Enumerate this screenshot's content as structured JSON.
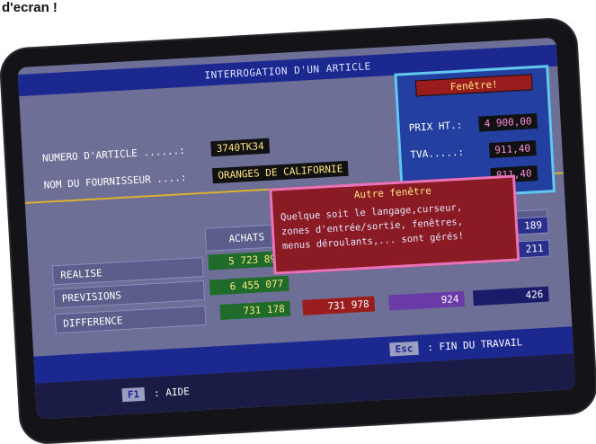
{
  "caption": "d'ecran !",
  "title": "INTERROGATION D'UN ARTICLE",
  "form": {
    "article_label": "NUMERO D'ARTICLE ......:",
    "article_value": "3740TK34",
    "supplier_label": "NOM DU FOURNISSEUR ....:",
    "supplier_value": "ORANGES DE CALIFORNIE"
  },
  "table": {
    "col_header": "ACHATS",
    "rows": [
      {
        "label": "REALISE",
        "c1": "5 723 899",
        "c4": "2 211"
      },
      {
        "label": "PREVISIONS",
        "c1": "6 455 077"
      },
      {
        "label": "DIFFERENCE",
        "c1": "731 178",
        "c2": "731 978",
        "c3": "924",
        "c4": "426"
      }
    ],
    "extra_top_right": "3 189"
  },
  "window1": {
    "title": "Fenêtre!",
    "prix_label": "PRIX HT.:",
    "prix_value": "4 900,00",
    "tva_label": "TVA.....:",
    "tva_value": "911,40",
    "total_value": "811,40"
  },
  "window2": {
    "title": "Autre fenêtre",
    "line1": "Quelque soit le langage,curseur,",
    "line2": "zones d'entrée/sortie, fenêtres,",
    "line3": "menus déroulants,... sont gérés!"
  },
  "status": {
    "esc_key": "Esc",
    "esc_label": ": FIN DU TRAVAIL",
    "f1_key": "F1",
    "f1_label": ": AIDE"
  },
  "colors": {
    "titlebar": "#1b2890",
    "window1": "#2340a0",
    "window2": "#8a1a24"
  }
}
